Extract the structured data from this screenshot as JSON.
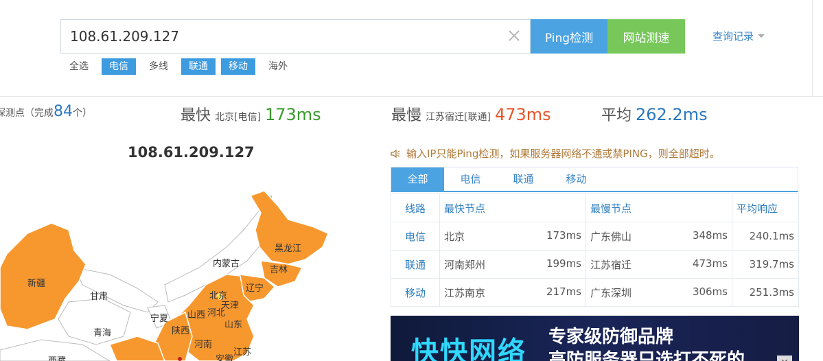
{
  "search": {
    "value": "108.61.209.127",
    "clear_icon": "close-icon"
  },
  "buttons": {
    "ping": "Ping检测",
    "speed": "网站测速"
  },
  "history": {
    "label": "查询记录"
  },
  "filters": [
    {
      "label": "全选",
      "active": false
    },
    {
      "label": "电信",
      "active": true
    },
    {
      "label": "多线",
      "active": false
    },
    {
      "label": "联通",
      "active": true
    },
    {
      "label": "移动",
      "active": true
    },
    {
      "label": "海外",
      "active": false
    }
  ],
  "summary": {
    "nodes_prefix": "探测点（完成",
    "nodes_count": "84",
    "nodes_suffix": "个）",
    "fastest_label": "最快",
    "fastest_node": "北京[电信]",
    "fastest_value": "173ms",
    "slowest_label": "最慢",
    "slowest_node": "江苏宿迁[联通]",
    "slowest_value": "473ms",
    "average_label": "平均",
    "average_value": "262.2ms"
  },
  "colors": {
    "fast": "#3a9a2e",
    "slow": "#e8552a",
    "avg": "#2a78bf",
    "count": "#2a78bf",
    "map_fill": "#f7982f"
  },
  "map": {
    "title": "108.61.209.127",
    "labels": [
      "黑龙江",
      "吉林",
      "辽宁",
      "内蒙古",
      "新疆",
      "甘肃",
      "青海",
      "宁夏",
      "陕西",
      "山西",
      "北京",
      "天津",
      "河北",
      "山东",
      "河南",
      "江苏",
      "安徽",
      "西藏"
    ]
  },
  "notice": {
    "icon": "speaker-icon",
    "text": "输入IP只能Ping检测，如果服务器网络不通或禁PING，则全部超时。"
  },
  "tabs": [
    {
      "label": "全部",
      "active": true
    },
    {
      "label": "电信",
      "active": false
    },
    {
      "label": "联通",
      "active": false
    },
    {
      "label": "移动",
      "active": false
    }
  ],
  "table": {
    "headers": [
      "线路",
      "最快节点",
      "最慢节点",
      "平均响应"
    ],
    "rows": [
      {
        "line": "电信",
        "fast_node": "北京",
        "fast_ms": "173ms",
        "slow_node": "广东佛山",
        "slow_ms": "348ms",
        "avg": "240.1ms"
      },
      {
        "line": "联通",
        "fast_node": "河南郑州",
        "fast_ms": "199ms",
        "slow_node": "江苏宿迁",
        "slow_ms": "473ms",
        "avg": "319.7ms"
      },
      {
        "line": "移动",
        "fast_node": "江苏南京",
        "fast_ms": "217ms",
        "slow_node": "广东深圳",
        "slow_ms": "306ms",
        "avg": "251.3ms"
      }
    ]
  },
  "banner": {
    "name": "快快网络",
    "line1": "专家级防御品牌",
    "line2": "高防服务器只选打不死的",
    "close_icon": "close-icon"
  }
}
